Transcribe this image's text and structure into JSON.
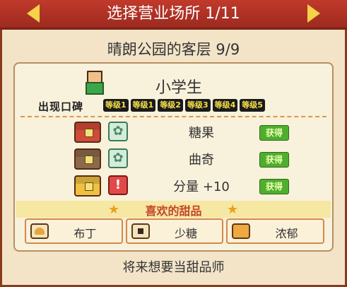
{
  "header": {
    "title": "选择营业场所 1/11"
  },
  "subtitle": "晴朗公园的客层 9/9",
  "customer": {
    "name": "小学生",
    "appear_label": "出现口碑",
    "levels": [
      "等级1",
      "等级1",
      "等级2",
      "等级3",
      "等级4",
      "等级5"
    ]
  },
  "conditions": [
    {
      "label": "糖果",
      "status": "获得",
      "chest_color": "#d24a3a",
      "icon": "gear-icon"
    },
    {
      "label": "曲奇",
      "status": "获得",
      "chest_color": "#8a6a4a",
      "icon": "gear-icon"
    },
    {
      "label": "分量 +10",
      "status": "获得",
      "chest_color": "#f0c040",
      "icon": "warning-icon"
    }
  ],
  "favorites": {
    "title": "喜欢的甜品",
    "items": [
      {
        "label": "布丁",
        "icon": "pudding-icon"
      },
      {
        "label": "少糖",
        "icon": "low-sugar-icon"
      },
      {
        "label": "浓郁",
        "icon": "rich-icon"
      }
    ]
  },
  "footer": "将来想要当甜品师",
  "colors": {
    "header": "#b2352a",
    "panel": "#f8f1dc",
    "accent": "#f6d24a",
    "obtained": "#4fae2e"
  }
}
